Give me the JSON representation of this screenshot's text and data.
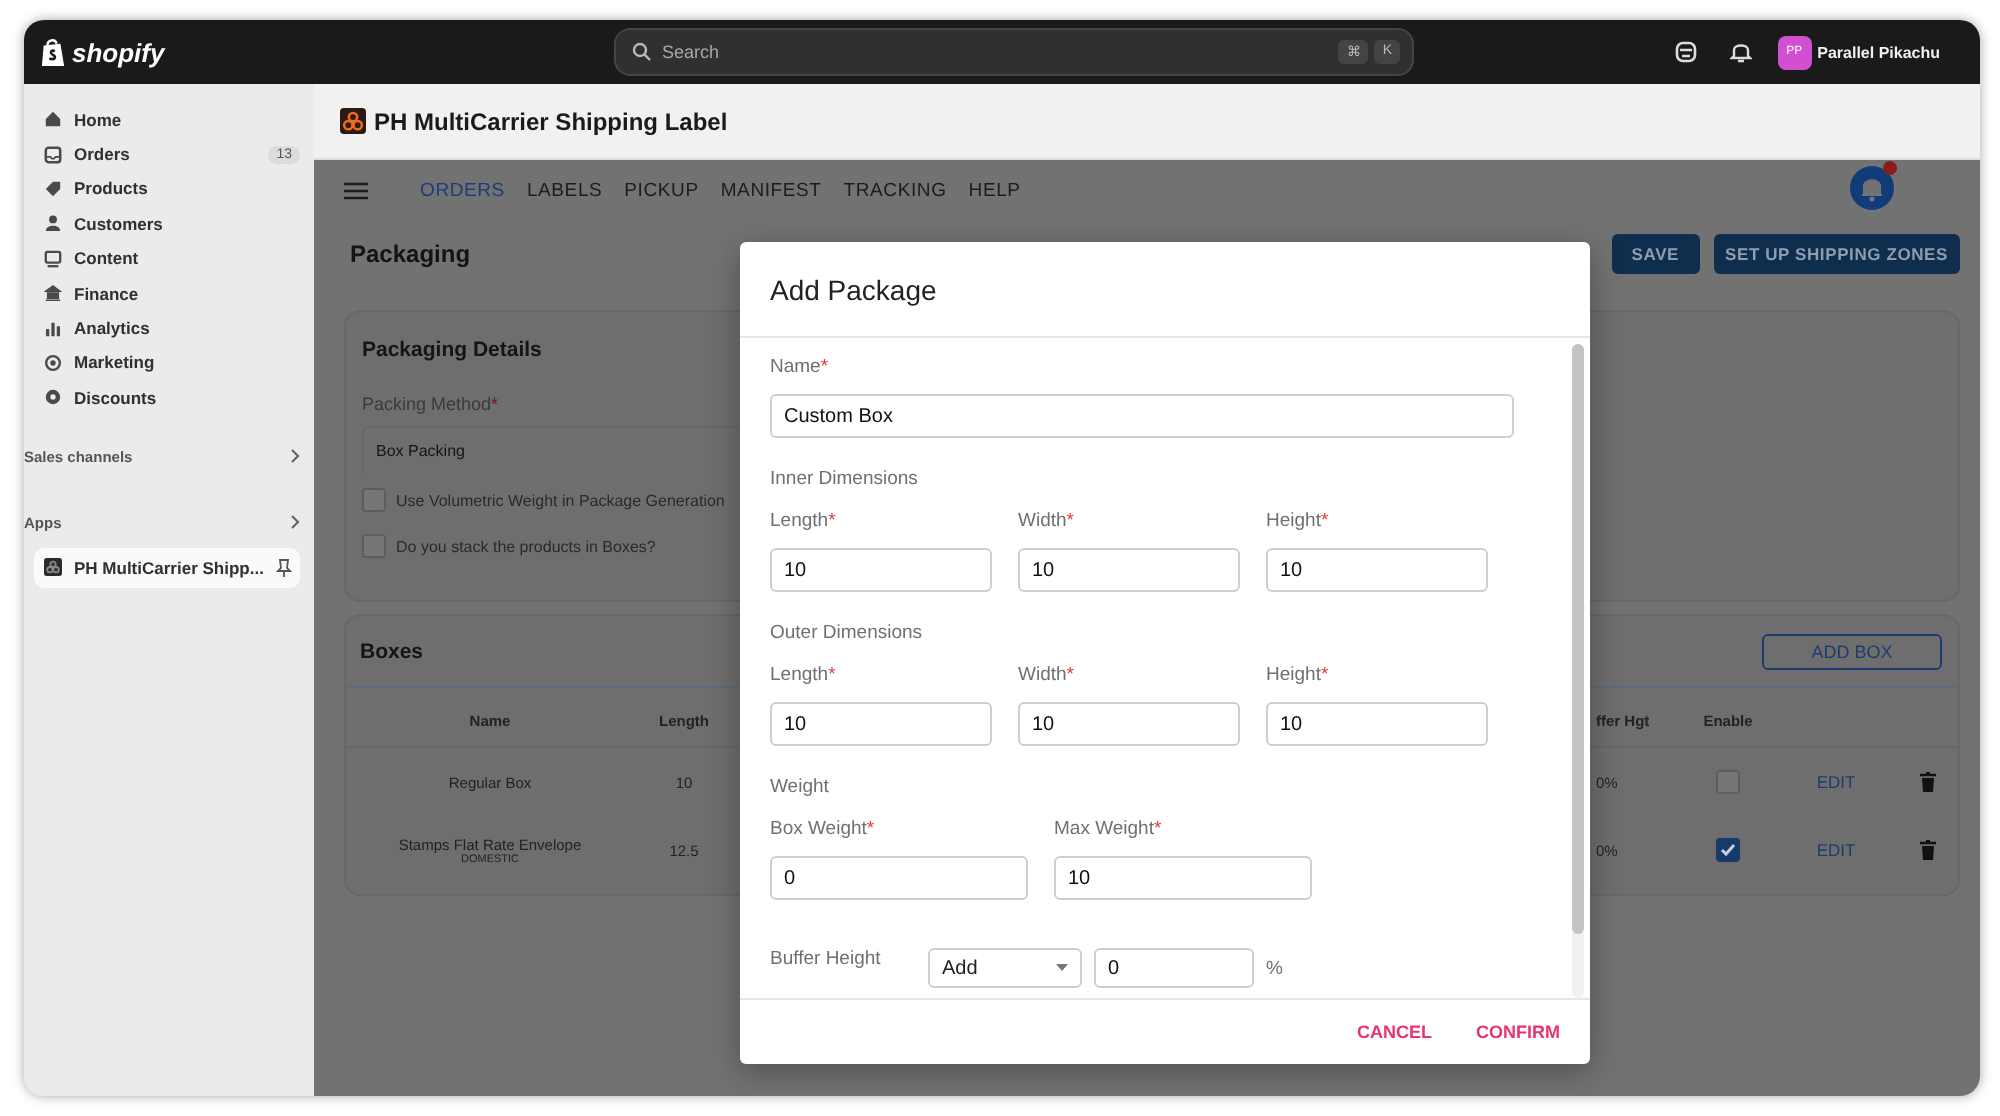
{
  "topbar": {
    "logo": "shopify",
    "search": {
      "placeholder": "Search"
    },
    "shortcut": [
      "⌘",
      "K"
    ],
    "user": {
      "initials": "PP",
      "name": "Parallel Pikachu"
    }
  },
  "sidebar": {
    "items": [
      {
        "label": "Home"
      },
      {
        "label": "Orders",
        "badge": "13"
      },
      {
        "label": "Products"
      },
      {
        "label": "Customers"
      },
      {
        "label": "Content"
      },
      {
        "label": "Finance"
      },
      {
        "label": "Analytics"
      },
      {
        "label": "Marketing"
      },
      {
        "label": "Discounts"
      }
    ],
    "sections": [
      {
        "label": "Sales channels"
      },
      {
        "label": "Apps"
      }
    ],
    "apps": [
      {
        "label": "PH MultiCarrier Shipp...",
        "selected": true
      }
    ]
  },
  "app_header": {
    "title": "PH MultiCarrier Shipping Label"
  },
  "nav": {
    "tabs": [
      {
        "label": "ORDERS",
        "selected": true
      },
      {
        "label": "LABELS",
        "selected": false
      },
      {
        "label": "PICKUP",
        "selected": false
      },
      {
        "label": "MANIFEST",
        "selected": false
      },
      {
        "label": "TRACKING",
        "selected": false
      },
      {
        "label": "HELP",
        "selected": false
      }
    ]
  },
  "page": {
    "title": "Packaging",
    "buttons": [
      "SAVE",
      "SET UP SHIPPING ZONES"
    ]
  },
  "details": {
    "title": "Packaging Details",
    "method": {
      "label": "Packing Method",
      "mark": "*",
      "value": "Box Packing"
    },
    "options": [
      {
        "label": "Use Volumetric Weight in Package Generation",
        "checked": false
      },
      {
        "label": "Do you stack the products in Boxes?",
        "checked": false
      }
    ]
  },
  "boxes": {
    "title": "Boxes",
    "add_button": "ADD BOX",
    "columns": [
      "Name",
      "Length",
      "ffer Hgt",
      "Enable"
    ],
    "rows": [
      {
        "name": "Regular Box",
        "length": "10",
        "buffer": "0%",
        "enabled": false,
        "action": "EDIT"
      },
      {
        "name": "Stamps Flat Rate Envelope",
        "tag": "DOMESTIC",
        "length": "12.5",
        "buffer": "0%",
        "enabled": true,
        "action": "EDIT"
      }
    ]
  },
  "modal": {
    "title": "Add Package",
    "name": {
      "label": "Name",
      "mark": "*",
      "value": "Custom Box"
    },
    "sections": [
      {
        "title": "Inner Dimensions",
        "fields": [
          {
            "label": "Length",
            "mark": "*",
            "value": "10"
          },
          {
            "label": "Width",
            "mark": "*",
            "value": "10"
          },
          {
            "label": "Height",
            "mark": "*",
            "value": "10"
          }
        ]
      },
      {
        "title": "Outer Dimensions",
        "fields": [
          {
            "label": "Length",
            "mark": "*",
            "value": "10"
          },
          {
            "label": "Width",
            "mark": "*",
            "value": "10"
          },
          {
            "label": "Height",
            "mark": "*",
            "value": "10"
          }
        ]
      },
      {
        "title": "Weight",
        "fields": [
          {
            "label": "Box Weight",
            "mark": "*",
            "value": "0"
          },
          {
            "label": "Max Weight",
            "mark": "*",
            "value": "10"
          }
        ]
      }
    ],
    "buffer": {
      "label": "Buffer Height",
      "mode": "Add",
      "value": "0",
      "unit": "%"
    },
    "actions": [
      "CANCEL",
      "CONFIRM"
    ]
  }
}
